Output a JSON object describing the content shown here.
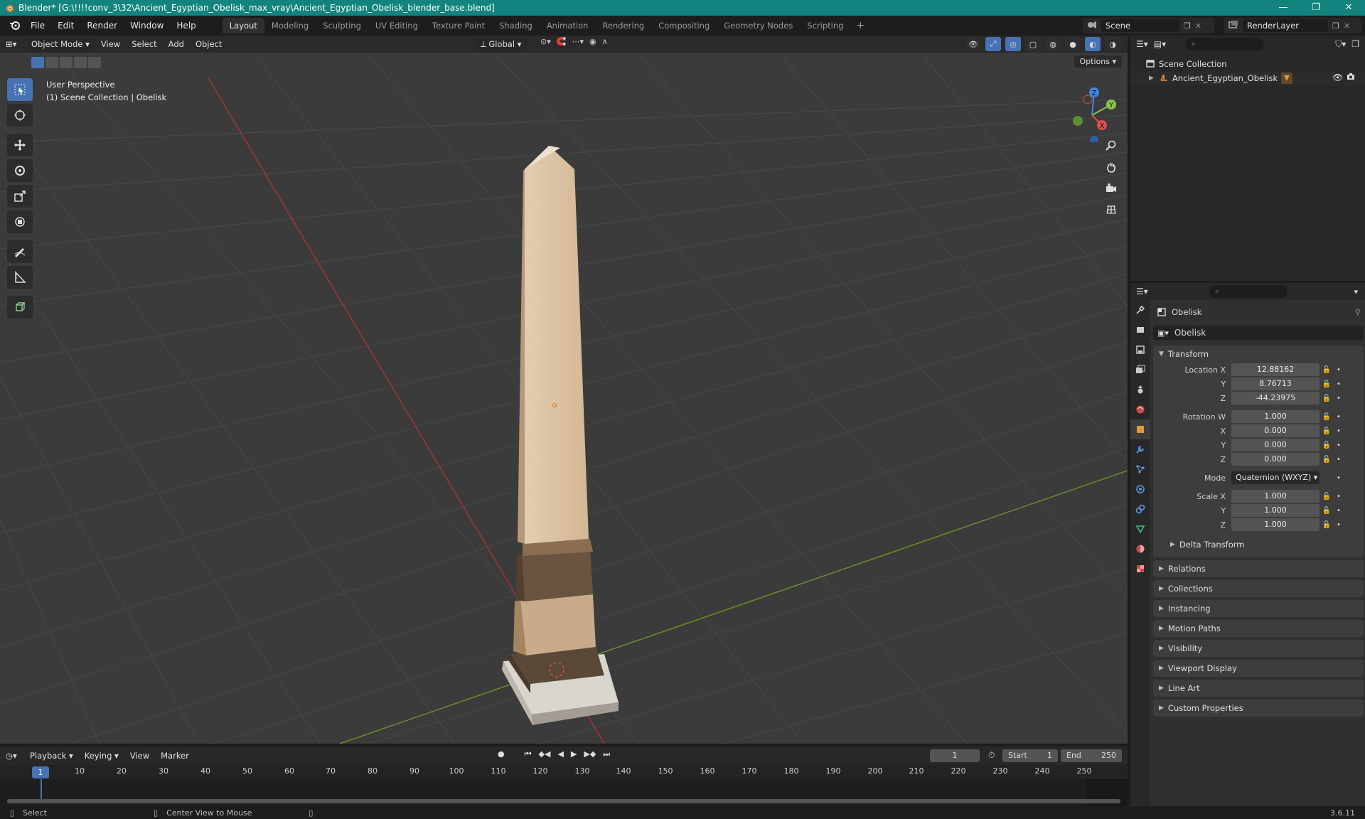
{
  "window": {
    "title": "Blender* [G:\\!!!!conv_3\\32\\Ancient_Egyptian_Obelisk_max_vray\\Ancient_Egyptian_Obelisk_blender_base.blend]",
    "minimize": "—",
    "maximize": "❐",
    "close": "✕"
  },
  "menu": {
    "items": [
      "File",
      "Edit",
      "Render",
      "Window",
      "Help"
    ],
    "workspaces": [
      "Layout",
      "Modeling",
      "Sculpting",
      "UV Editing",
      "Texture Paint",
      "Shading",
      "Animation",
      "Rendering",
      "Compositing",
      "Geometry Nodes",
      "Scripting"
    ],
    "add_workspace": "+",
    "scene": "Scene",
    "render_layer": "RenderLayer"
  },
  "viewport": {
    "mode": "Object Mode",
    "menus": [
      "View",
      "Select",
      "Add",
      "Object"
    ],
    "transform_orientation": "Global",
    "options": "Options",
    "info_line1": "User Perspective",
    "info_line2": "(1) Scene Collection | Obelisk",
    "gizmo_axes": {
      "x": "X",
      "y": "Y",
      "z": "Z"
    }
  },
  "outliner": {
    "search_placeholder": "",
    "root": "Scene Collection",
    "items": [
      {
        "label": "Ancient_Egyptian_Obelisk"
      }
    ]
  },
  "properties": {
    "object_name": "Obelisk",
    "data_name": "Obelisk",
    "transform": {
      "title": "Transform",
      "location_label": "Location X",
      "location": [
        "12.88162",
        "8.76713",
        "-44.23975"
      ],
      "rotation_label": "Rotation W",
      "rotation": [
        "1.000",
        "0.000",
        "0.000",
        "0.000"
      ],
      "mode_label": "Mode",
      "mode_value": "Quaternion (WXYZ)",
      "scale_label": "Scale X",
      "scale": [
        "1.000",
        "1.000",
        "1.000"
      ],
      "axis_y": "Y",
      "axis_z": "Z",
      "axis_x": "X",
      "delta": "Delta Transform"
    },
    "panels": [
      "Relations",
      "Collections",
      "Instancing",
      "Motion Paths",
      "Visibility",
      "Viewport Display",
      "Line Art",
      "Custom Properties"
    ]
  },
  "timeline": {
    "menus": [
      "Playback",
      "Keying",
      "View",
      "Marker"
    ],
    "current_frame": "1",
    "start_label": "Start",
    "start": "1",
    "end_label": "End",
    "end": "250",
    "ticks": [
      "1",
      "10",
      "20",
      "30",
      "40",
      "50",
      "60",
      "70",
      "80",
      "90",
      "100",
      "110",
      "120",
      "130",
      "140",
      "150",
      "160",
      "170",
      "180",
      "190",
      "200",
      "210",
      "220",
      "230",
      "240",
      "250"
    ]
  },
  "status": {
    "select": "Select",
    "center": "Center View to Mouse",
    "version": "3.6.11"
  },
  "colors": {
    "accent": "#4772b3",
    "titlebar": "#13847d",
    "x_axis": "#e24c4c",
    "y_axis": "#8bc34a",
    "z_axis": "#3f86e8"
  }
}
